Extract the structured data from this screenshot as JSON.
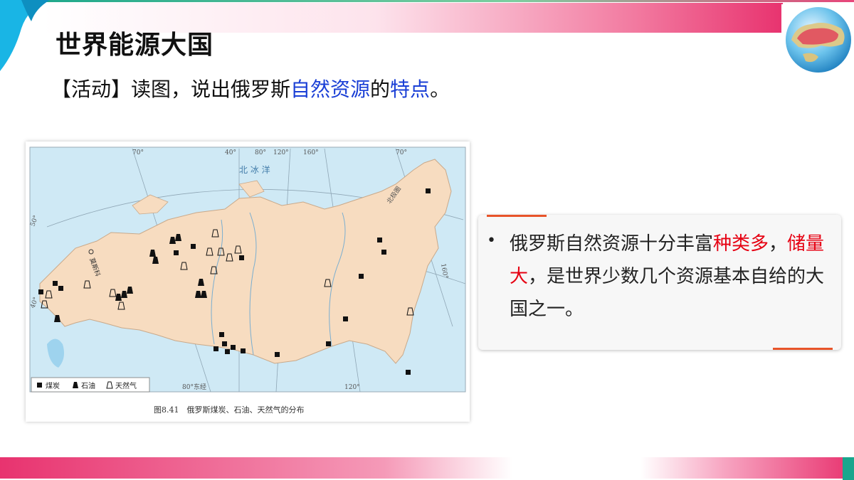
{
  "slide": {
    "title": "世界能源大国",
    "activity": {
      "part1": "【活动】读图，说出俄罗斯",
      "highlight1": "自然资源",
      "part2": "的",
      "highlight2": "特点",
      "part3": "。"
    }
  },
  "map": {
    "ocean_label": "北 冰 洋",
    "moscow_label": "莫斯科",
    "arctic_circle_label": "北极圈",
    "meridian_label": "80°东经",
    "lon_labels": [
      "70°",
      "40°",
      "80°",
      "120°",
      "160°",
      "70°",
      "120°",
      "160°"
    ],
    "lat_labels": [
      "50°",
      "40°"
    ],
    "legend": {
      "coal": "煤炭",
      "oil": "石油",
      "gas": "天然气"
    },
    "caption": "图8.41　俄罗斯煤炭、石油、天然气的分布"
  },
  "info_card": {
    "bullet": "•",
    "text1": "俄罗斯自然资源十分丰富",
    "red1": "种类多",
    "text2": "，",
    "red2": "储量大",
    "text3": "，是世界少数几个资源基本自给的大国之一。"
  },
  "colors": {
    "accent_blue": "#1a3fd6",
    "accent_red": "#e60012",
    "pink": "#e8336f",
    "green": "#19a68d",
    "land": "#f7dcc0",
    "sea": "#cfe9f5"
  }
}
